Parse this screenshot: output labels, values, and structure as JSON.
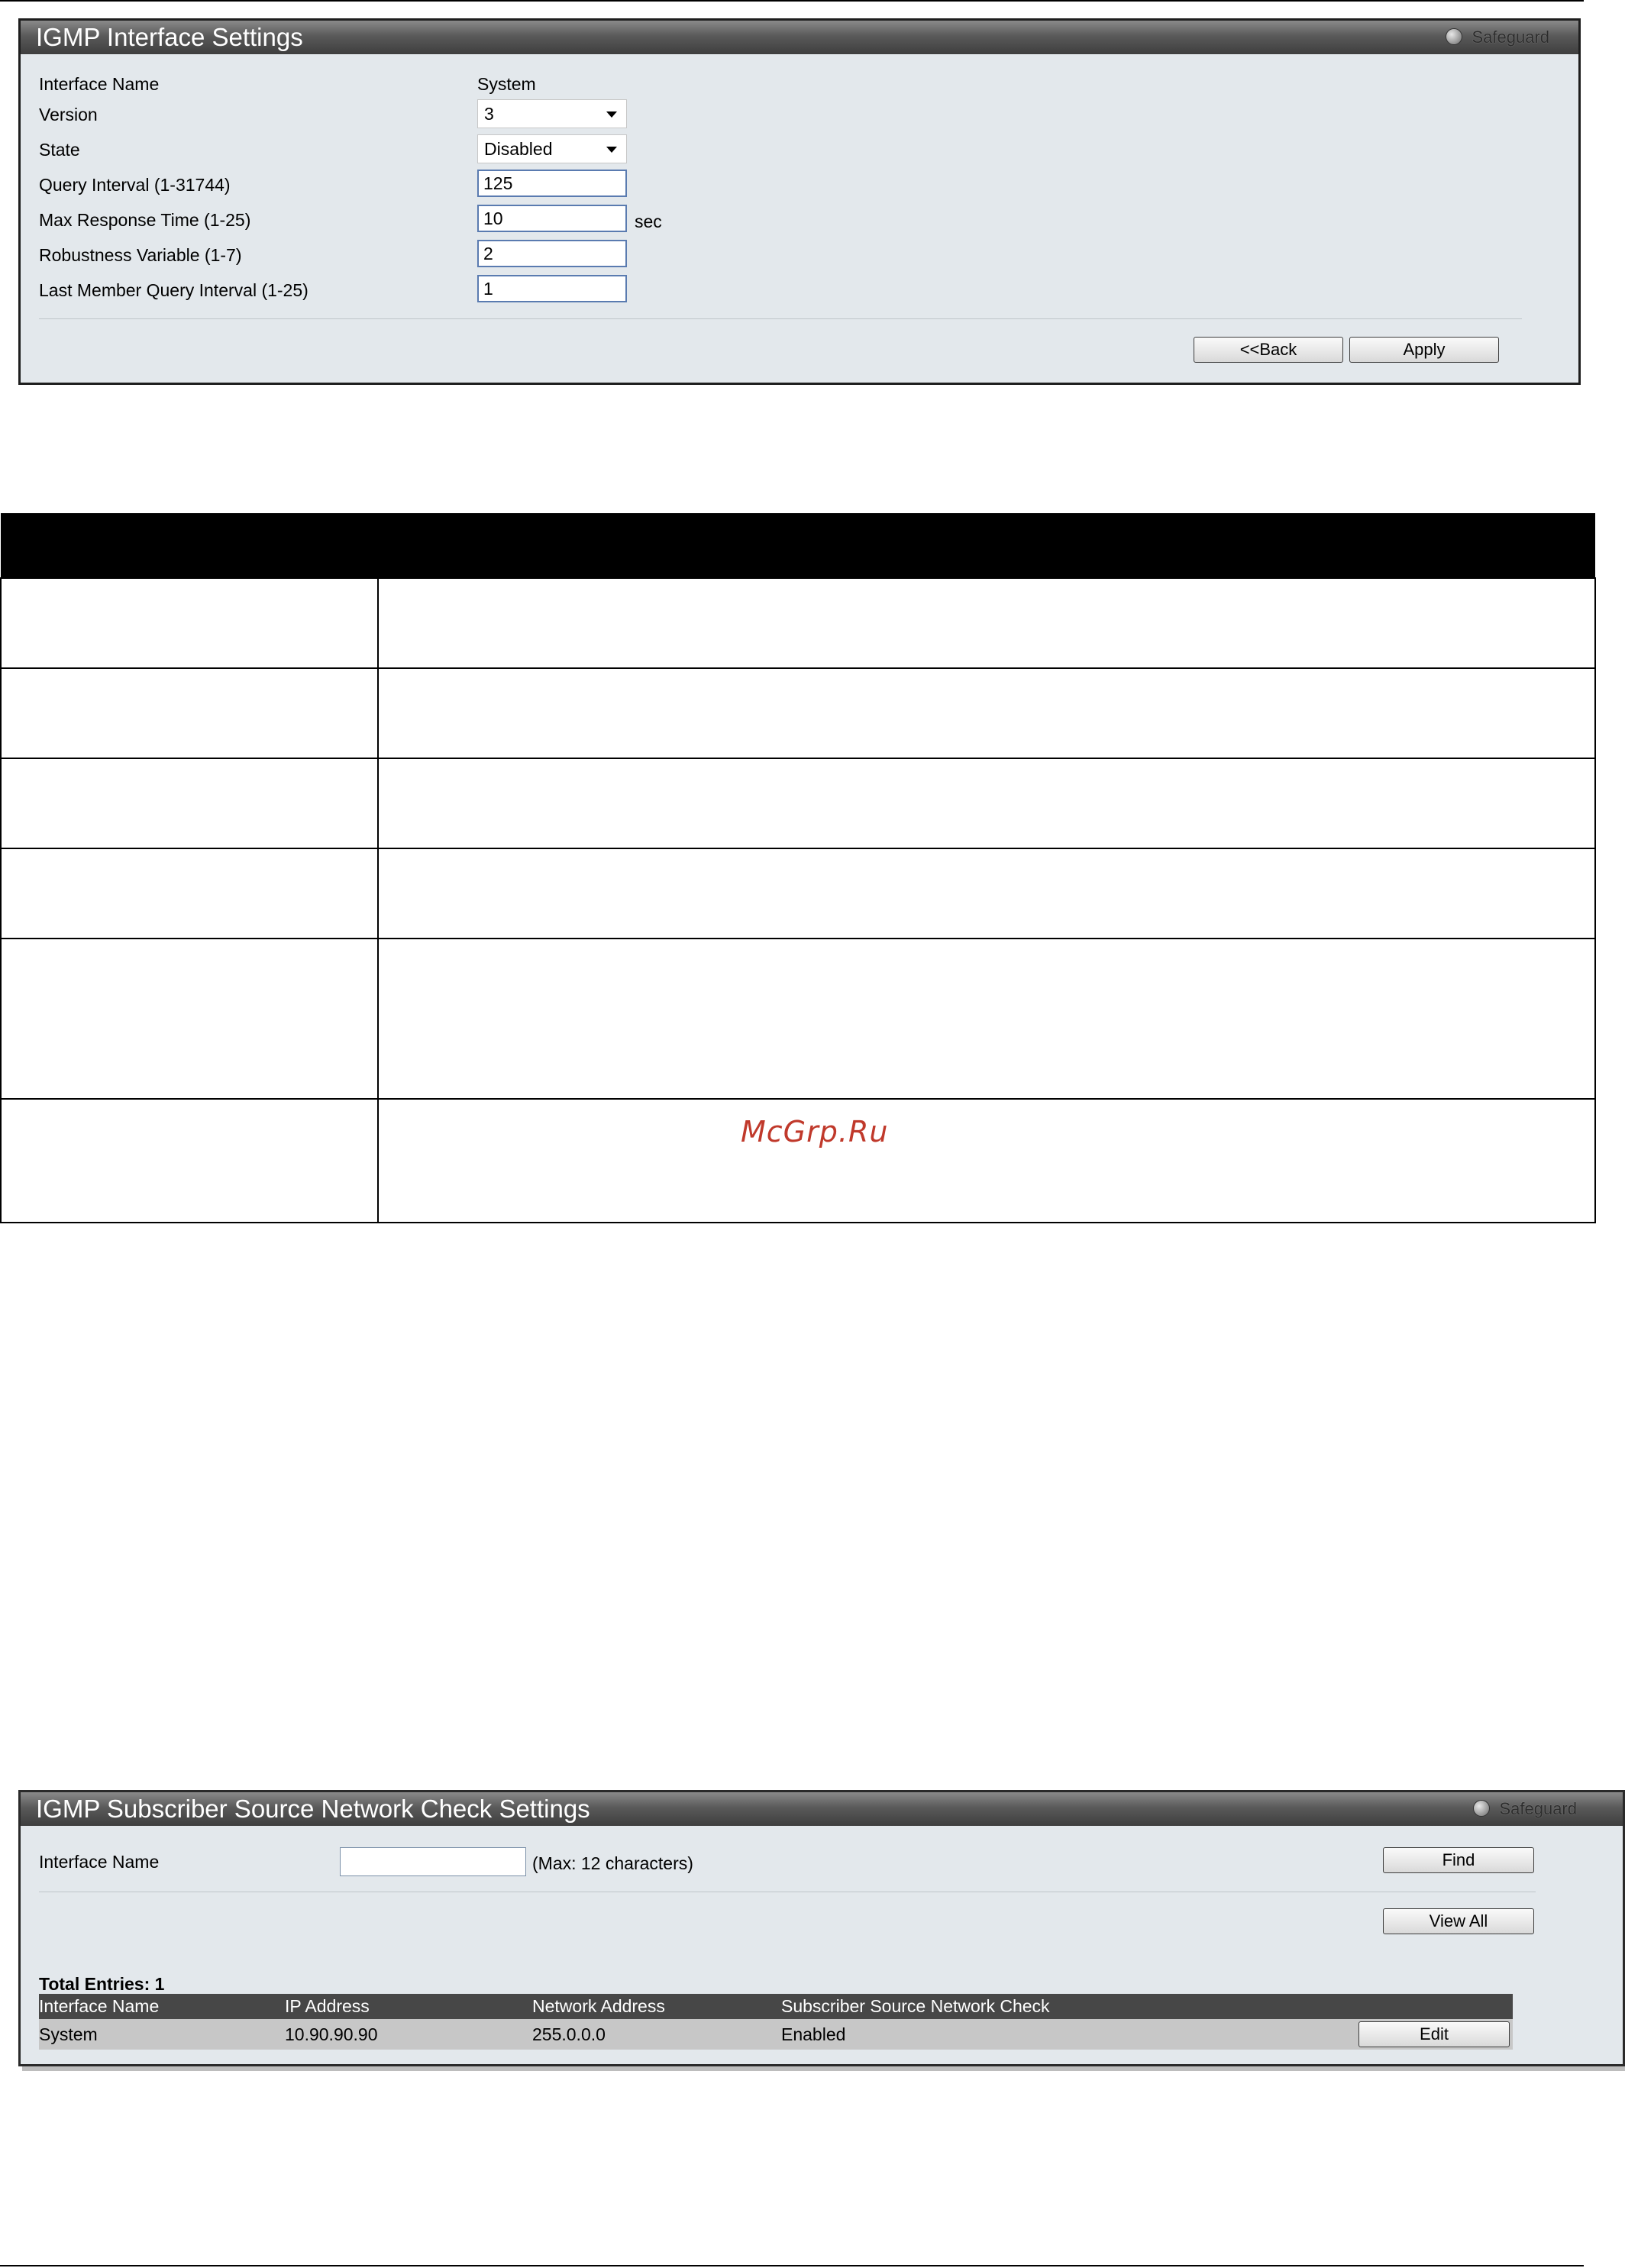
{
  "interface_settings": {
    "title": "IGMP Interface Settings",
    "safeguard": "Safeguard",
    "fields": {
      "interface_name": {
        "label": "Interface Name",
        "value": "System"
      },
      "version": {
        "label": "Version",
        "value": "3"
      },
      "state": {
        "label": "State",
        "value": "Disabled"
      },
      "query_interval": {
        "label": "Query Interval (1-31744)",
        "value": "125"
      },
      "max_response_time": {
        "label": "Max Response Time (1-25)",
        "value": "10",
        "unit": "sec"
      },
      "robustness_variable": {
        "label": "Robustness Variable (1-7)",
        "value": "2"
      },
      "last_member_query_interval": {
        "label": "Last Member Query Interval (1-25)",
        "value": "1"
      }
    },
    "buttons": {
      "back": "<<Back",
      "apply": "Apply"
    }
  },
  "watermark": "McGrp.Ru",
  "subscriber_settings": {
    "title": "IGMP Subscriber Source Network Check Settings",
    "safeguard": "Safeguard",
    "interface_name_label": "Interface Name",
    "interface_name_value": "",
    "max_hint": "(Max: 12 characters)",
    "find_button": "Find",
    "view_all_button": "View All",
    "total_entries": "Total Entries: 1",
    "columns": [
      "Interface Name",
      "IP Address",
      "Network Address",
      "Subscriber Source Network Check"
    ],
    "rows": [
      {
        "interface_name": "System",
        "ip_address": "10.90.90.90",
        "network_address": "255.0.0.0",
        "check": "Enabled",
        "edit": "Edit"
      }
    ]
  }
}
